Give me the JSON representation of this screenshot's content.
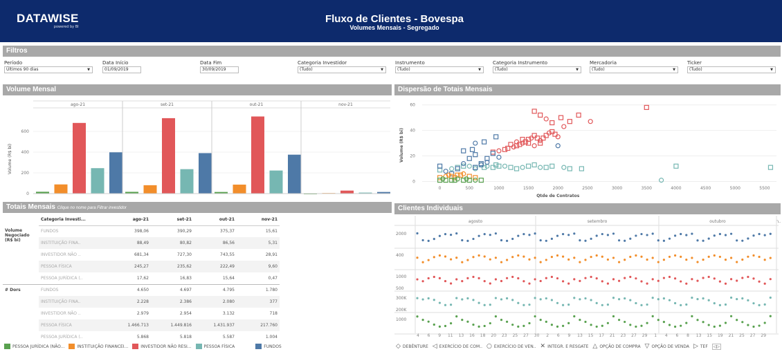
{
  "header": {
    "logo": "DATAWISE",
    "logo_sub": "powered by BI",
    "title": "Fluxo de Clientes - Bovespa",
    "subtitle": "Volumes Mensais - Segregado",
    "bg": "#0d2a6c"
  },
  "sections": {
    "filters": "Filtros",
    "volume": "Volume Mensal",
    "dispersion": "Dispersão de Totais Mensais",
    "totals": "Totais Mensais",
    "totals_hint": "Clique no nome para Filtrar investidor",
    "clients": "Clientes Individuais"
  },
  "filters": [
    {
      "label": "Período",
      "value": "Últimos 90 dias"
    },
    {
      "label": "Data Início",
      "value": "01/09/2019"
    },
    {
      "label": "Data Fim",
      "value": "30/09/2019"
    },
    {
      "label": "Categoria Investidor",
      "value": "(Tudo)"
    },
    {
      "label": "Instrumento",
      "value": "(Tudo)"
    },
    {
      "label": "Categoria Instrumento",
      "value": "(Tudo)"
    },
    {
      "label": "Mercadoria",
      "value": "(Tudo)"
    },
    {
      "label": "Ticker",
      "value": "(Tudo)"
    }
  ],
  "colors": {
    "pj": "#59a14f",
    "inst": "#f28e2b",
    "inv": "#e15759",
    "pf": "#76b7b2",
    "fundos": "#4e79a7"
  },
  "chart_data": [
    {
      "type": "bar",
      "title": "Volume Mensal",
      "ylabel": "Volume (R$ bi)",
      "ylim": [
        0,
        800
      ],
      "yticks": [
        0,
        200,
        400,
        600
      ],
      "categories": [
        "ago-21",
        "set-21",
        "out-21",
        "nov-21"
      ],
      "series": [
        {
          "name": "PESSOA JURÍDICA (NÃO...",
          "values": [
            17.62,
            16.83,
            15.64,
            0.47
          ]
        },
        {
          "name": "INSTITUIÇÃO FINANCEI...",
          "values": [
            88.49,
            80.82,
            86.56,
            5.31
          ]
        },
        {
          "name": "INVESTIDOR NÃO RESI...",
          "values": [
            681.34,
            727.3,
            743.55,
            28.91
          ]
        },
        {
          "name": "PESSOA FÍSICA",
          "values": [
            245.27,
            235.62,
            222.49,
            9.6
          ]
        },
        {
          "name": "FUNDOS",
          "values": [
            398.06,
            390.29,
            375.37,
            15.61
          ]
        }
      ]
    },
    {
      "type": "scatter",
      "title": "Dispersão de Totais Mensais",
      "xlabel": "Qtde de Contratos",
      "ylabel": "Volume (R$ bi)",
      "xlim": [
        -300,
        5700
      ],
      "ylim": [
        -3,
        62
      ],
      "xticks": [
        0,
        500,
        1000,
        1500,
        2000,
        2500,
        3000,
        3500,
        4000,
        4500,
        5000,
        5500
      ],
      "yticks": [
        0,
        20,
        40,
        60
      ],
      "series": [
        {
          "name": "INVESTIDOR NÃO RESI...",
          "points": [
            [
              900,
              23
            ],
            [
              1000,
              24
            ],
            [
              1100,
              25
            ],
            [
              1150,
              26
            ],
            [
              1250,
              27
            ],
            [
              1300,
              28
            ],
            [
              1350,
              29
            ],
            [
              1400,
              30
            ],
            [
              1450,
              31
            ],
            [
              1500,
              33
            ],
            [
              1550,
              34
            ],
            [
              1600,
              36
            ],
            [
              1650,
              34
            ],
            [
              1700,
              32
            ],
            [
              1750,
              34
            ],
            [
              1800,
              36
            ],
            [
              1850,
              38
            ],
            [
              1900,
              39
            ],
            [
              1950,
              37
            ],
            [
              2000,
              35
            ],
            [
              1600,
              55
            ],
            [
              1700,
              52
            ],
            [
              1800,
              49
            ],
            [
              1900,
              46
            ],
            [
              2050,
              50
            ],
            [
              2100,
              43
            ],
            [
              2200,
              47
            ],
            [
              2350,
              52
            ],
            [
              2550,
              47
            ],
            [
              3500,
              58
            ],
            [
              1200,
              29
            ],
            [
              1300,
              31
            ],
            [
              1400,
              33
            ],
            [
              1500,
              30
            ],
            [
              1600,
              28
            ],
            [
              1700,
              30
            ]
          ]
        },
        {
          "name": "PESSOA FÍSICA",
          "points": [
            [
              0,
              9
            ],
            [
              200,
              10
            ],
            [
              300,
              11
            ],
            [
              400,
              12
            ],
            [
              500,
              12
            ],
            [
              600,
              11
            ],
            [
              700,
              13
            ],
            [
              800,
              12
            ],
            [
              900,
              11
            ],
            [
              1000,
              12
            ],
            [
              1100,
              12
            ],
            [
              1200,
              11
            ],
            [
              1300,
              10
            ],
            [
              1400,
              11
            ],
            [
              1500,
              12
            ],
            [
              1600,
              13
            ],
            [
              1700,
              11
            ],
            [
              1800,
              11
            ],
            [
              1900,
              12
            ],
            [
              2100,
              11
            ],
            [
              2200,
              10
            ],
            [
              2400,
              10
            ],
            [
              3750,
              1
            ],
            [
              4000,
              12
            ],
            [
              5600,
              11
            ],
            [
              600,
              10
            ],
            [
              750,
              11
            ],
            [
              950,
              13
            ]
          ]
        },
        {
          "name": "FUNDOS",
          "points": [
            [
              0,
              12
            ],
            [
              100,
              8
            ],
            [
              200,
              6
            ],
            [
              300,
              10
            ],
            [
              400,
              14
            ],
            [
              500,
              18
            ],
            [
              600,
              21
            ],
            [
              700,
              13
            ],
            [
              800,
              18
            ],
            [
              900,
              22
            ],
            [
              1000,
              19
            ],
            [
              600,
              11
            ],
            [
              700,
              14
            ],
            [
              800,
              15
            ],
            [
              400,
              24
            ],
            [
              550,
              25
            ],
            [
              600,
              30
            ],
            [
              750,
              31
            ],
            [
              950,
              35
            ],
            [
              2000,
              28
            ]
          ]
        },
        {
          "name": "INSTITUIÇÃO FINANCEI...",
          "points": [
            [
              0,
              3
            ],
            [
              100,
              4
            ],
            [
              200,
              4
            ],
            [
              300,
              5
            ],
            [
              400,
              6
            ],
            [
              500,
              4
            ],
            [
              600,
              3
            ],
            [
              150,
              5
            ],
            [
              250,
              3
            ],
            [
              350,
              5
            ]
          ]
        },
        {
          "name": "PESSOA JURÍDICA (NÃO...",
          "points": [
            [
              0,
              1
            ],
            [
              50,
              2
            ],
            [
              100,
              1
            ],
            [
              200,
              1
            ],
            [
              300,
              2
            ],
            [
              400,
              1
            ],
            [
              500,
              1
            ],
            [
              600,
              1
            ],
            [
              700,
              1
            ],
            [
              250,
              1
            ],
            [
              450,
              2
            ]
          ]
        }
      ]
    }
  ],
  "table": {
    "cols": [
      "Categoria Investi...",
      "ago-21",
      "set-21",
      "out-21",
      "nov-21"
    ],
    "groups": [
      {
        "label": "Volume Negociado (R$ bi)",
        "rows": [
          [
            "FUNDOS",
            "398,06",
            "390,29",
            "375,37",
            "15,61"
          ],
          [
            "INSTITUIÇÃO FINA..",
            "88,49",
            "80,82",
            "86,56",
            "5,31"
          ],
          [
            "INVESTIDOR NÃO ..",
            "681,34",
            "727,30",
            "743,55",
            "28,91"
          ],
          [
            "PESSOA FÍSICA",
            "245,27",
            "235,62",
            "222,49",
            "9,60"
          ],
          [
            "PESSOA JURÍDICA (..",
            "17,62",
            "16,83",
            "15,64",
            "0,47"
          ]
        ]
      },
      {
        "label": "# Dors",
        "rows": [
          [
            "FUNDOS",
            "4.650",
            "4.697",
            "4.795",
            "1.780"
          ],
          [
            "INSTITUIÇÃO FINA..",
            "2.228",
            "2.386",
            "2.080",
            "377"
          ],
          [
            "INVESTIDOR NÃO ..",
            "2.979",
            "2.954",
            "3.132",
            "718"
          ],
          [
            "PESSOA FÍSICA",
            "1.466.713",
            "1.449.816",
            "1.431.937",
            "217.760"
          ],
          [
            "PESSOA JURÍDICA (..",
            "5.868",
            "5.818",
            "5.587",
            "1.004"
          ]
        ]
      }
    ]
  },
  "clients": {
    "months": [
      "agosto",
      "setembro",
      "outubro",
      "n.."
    ],
    "row_labels": [
      "2000",
      "400",
      "1000",
      "300K",
      "1000"
    ],
    "row_labels2": [
      "",
      "",
      "500",
      "200K",
      ""
    ],
    "xticks": [
      "4",
      "6",
      "9",
      "11",
      "13",
      "16",
      "18",
      "20",
      "23",
      "25",
      "27",
      "30",
      "2",
      "6",
      "9",
      "13",
      "15",
      "17",
      "21",
      "23",
      "27",
      "29",
      "1",
      "4",
      "6",
      "8",
      "13",
      "15",
      "19",
      "21",
      "25",
      "27",
      "29"
    ]
  },
  "legend_left": [
    "PESSOA JURÍDICA (NÃO...",
    "INSTITUIÇÃO FINANCEI...",
    "INVESTIDOR NÃO RESI...",
    "PESSOA FÍSICA",
    "FUNDOS"
  ],
  "legend_right": [
    {
      "icon": "diamond-icon",
      "glyph": "◇",
      "label": "DEBÊNTURE"
    },
    {
      "icon": "triangle-left-icon",
      "glyph": "◁",
      "label": "EXERCÍCIO DE COM.."
    },
    {
      "icon": "circle-icon",
      "glyph": "○",
      "label": "EXERCÍCIO DE VEN.."
    },
    {
      "icon": "cross-icon",
      "glyph": "✕",
      "label": "INTEGR. E RESGATE"
    },
    {
      "icon": "triangle-up-icon",
      "glyph": "△",
      "label": "OPÇÃO DE COMPRA"
    },
    {
      "icon": "triangle-down-icon",
      "glyph": "▽",
      "label": "OPÇÃO DE VENDA"
    },
    {
      "icon": "triangle-right-icon",
      "glyph": "▷",
      "label": "TEF"
    }
  ],
  "legend_nav": "◁▷"
}
